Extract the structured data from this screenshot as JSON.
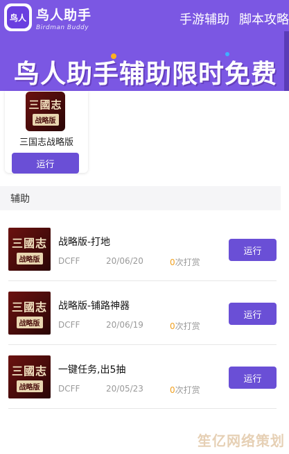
{
  "brand": {
    "logo_text": "鸟人",
    "name": "鸟人助手",
    "tagline": "Birdman Buddy"
  },
  "nav": {
    "items": [
      "手游辅助",
      "脚本攻略"
    ]
  },
  "banner": {
    "text": "鸟人助手辅助限时免费"
  },
  "featured": {
    "icon_line1": "三國志",
    "icon_line2": "战略版",
    "title": "三国志战略版",
    "button": "运行"
  },
  "section": {
    "title": "辅助"
  },
  "scripts": [
    {
      "icon_line1": "三國志",
      "icon_line2": "战略版",
      "title": "战略版-打地",
      "author": "DCFF",
      "date": "20/06/20",
      "reward_count": "0",
      "reward_label": "次打赏",
      "button": "运行"
    },
    {
      "icon_line1": "三國志",
      "icon_line2": "战略版",
      "title": "战略版-铺路神器",
      "author": "DCFF",
      "date": "20/06/19",
      "reward_count": "0",
      "reward_label": "次打赏",
      "button": "运行"
    },
    {
      "icon_line1": "三國志",
      "icon_line2": "战略版",
      "title": "一键任务,出5抽",
      "author": "DCFF",
      "date": "20/05/23",
      "reward_count": "0",
      "reward_label": "次打赏",
      "button": "运行"
    }
  ],
  "watermark": "笙亿网络策划",
  "colors": {
    "header_bg": "#7b57e3",
    "button_bg": "#6a4fd6",
    "reward_count": "#f0a020"
  }
}
